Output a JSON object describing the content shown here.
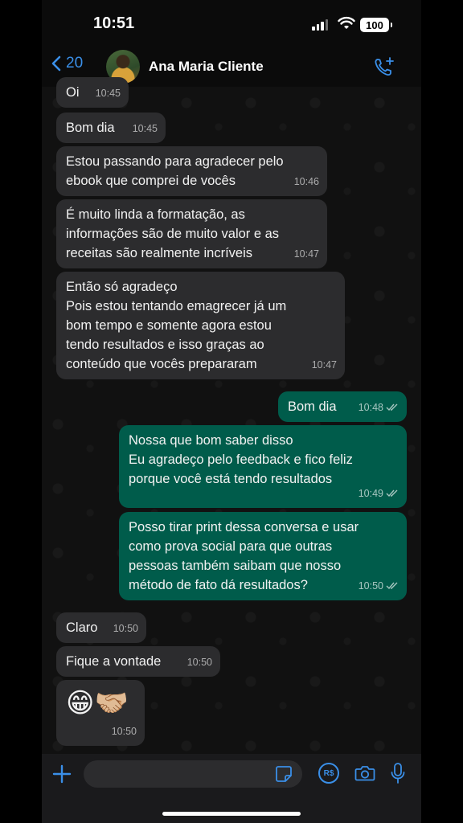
{
  "status_bar": {
    "time": "10:51",
    "battery": "100"
  },
  "header": {
    "back_count": "20",
    "contact_name": "Ana Maria Cliente"
  },
  "messages": [
    {
      "dir": "in",
      "text": "Oi",
      "time": "10:45"
    },
    {
      "dir": "in",
      "text": "Bom dia",
      "time": "10:45"
    },
    {
      "dir": "in",
      "text": "Estou passando para agradecer pelo\nebook que comprei de vocês",
      "time": "10:46"
    },
    {
      "dir": "in",
      "text": "É muito linda a formatação, as\ninformações são de muito valor e as\nreceitas são realmente incríveis",
      "time": "10:47"
    },
    {
      "dir": "in",
      "text": "Então só agradeço\nPois estou tentando emagrecer já um\nbom tempo e somente agora estou\ntendo resultados e isso graças ao\nconteúdo que vocês prepararam",
      "time": "10:47"
    },
    {
      "dir": "out",
      "text": "Bom dia",
      "time": "10:48"
    },
    {
      "dir": "out",
      "text": "Nossa que bom saber disso\nEu agradeço pelo feedback e fico feliz\nporque você está tendo resultados",
      "time": "10:49"
    },
    {
      "dir": "out",
      "text": "Posso tirar print dessa conversa e usar\ncomo prova social para que outras\npessoas também saibam que nosso\nmétodo de fato dá resultados?",
      "time": "10:50"
    },
    {
      "dir": "in",
      "text": "Claro",
      "time": "10:50"
    },
    {
      "dir": "in",
      "text": "Fique a vontade",
      "time": "10:50"
    },
    {
      "dir": "in",
      "text": "😁🤝🏼",
      "time": "10:50"
    }
  ],
  "input_bar": {
    "placeholder": "",
    "pay_label": "R$"
  },
  "colors": {
    "accent": "#3a8fe8",
    "incoming": "#2c2c2e",
    "outgoing": "#005c4b"
  }
}
